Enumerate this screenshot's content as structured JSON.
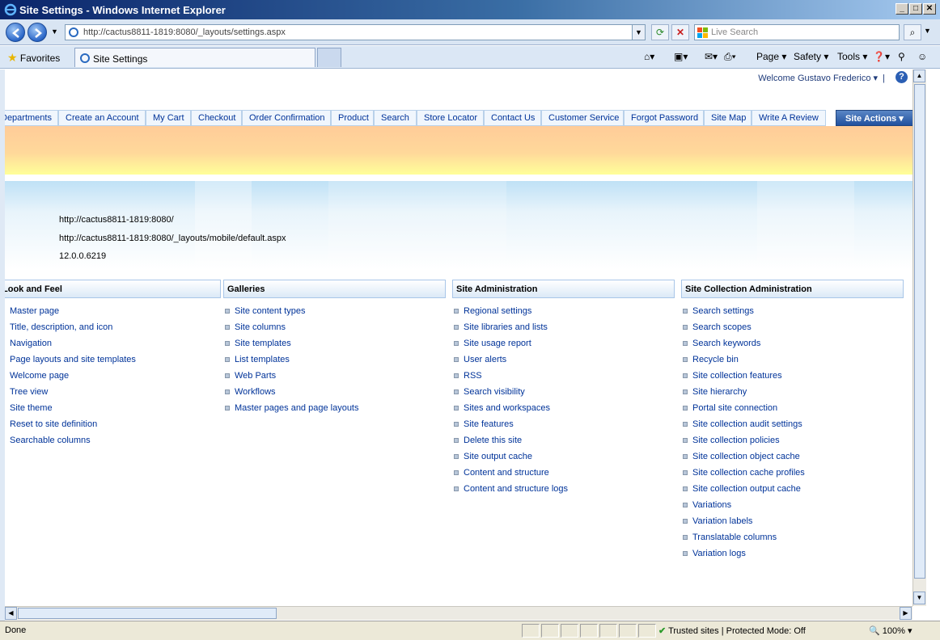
{
  "window": {
    "title": "Site Settings - Windows Internet Explorer"
  },
  "address": {
    "url": "http://cactus8811-1819:8080/_layouts/settings.aspx",
    "search_placeholder": "Live Search"
  },
  "commandbar": {
    "favorites": "Favorites",
    "tab_title": "Site Settings",
    "page": "Page",
    "safety": "Safety",
    "tools": "Tools"
  },
  "header": {
    "welcome": "Welcome Gustavo Frederico",
    "help_icon": "help-icon"
  },
  "topnav": {
    "items": [
      "Departments",
      "Create an Account",
      "My Cart",
      "Checkout",
      "Order Confirmation",
      "Product",
      "Search",
      "Store Locator",
      "Contact Us",
      "Customer Service",
      "Forgot Password",
      "Site Map",
      "Write A Review"
    ],
    "site_actions": "Site Actions"
  },
  "site_info": {
    "site_url": "http://cactus8811-1819:8080/",
    "mobile_url": "http://cactus8811-1819:8080/_layouts/mobile/default.aspx",
    "version": "12.0.0.6219"
  },
  "sections": [
    {
      "title": "Look and Feel",
      "links": [
        "Master page",
        "Title, description, and icon",
        "Navigation",
        "Page layouts and site templates",
        "Welcome page",
        "Tree view",
        "Site theme",
        "Reset to site definition",
        "Searchable columns"
      ]
    },
    {
      "title": "Galleries",
      "links": [
        "Site content types",
        "Site columns",
        "Site templates",
        "List templates",
        "Web Parts",
        "Workflows",
        "Master pages and page layouts"
      ]
    },
    {
      "title": "Site Administration",
      "links": [
        "Regional settings",
        "Site libraries and lists",
        "Site usage report",
        "User alerts",
        "RSS",
        "Search visibility",
        "Sites and workspaces",
        "Site features",
        "Delete this site",
        "Site output cache",
        "Content and structure",
        "Content and structure logs"
      ]
    },
    {
      "title": "Site Collection Administration",
      "links": [
        "Search settings",
        "Search scopes",
        "Search keywords",
        "Recycle bin",
        "Site collection features",
        "Site hierarchy",
        "Portal site connection",
        "Site collection audit settings",
        "Site collection policies",
        "Site collection object cache",
        "Site collection cache profiles",
        "Site collection output cache",
        "Variations",
        "Variation labels",
        "Translatable columns",
        "Variation logs"
      ]
    }
  ],
  "status": {
    "text": "Done",
    "zone": "Trusted sites | Protected Mode: Off",
    "zoom": "100%"
  }
}
